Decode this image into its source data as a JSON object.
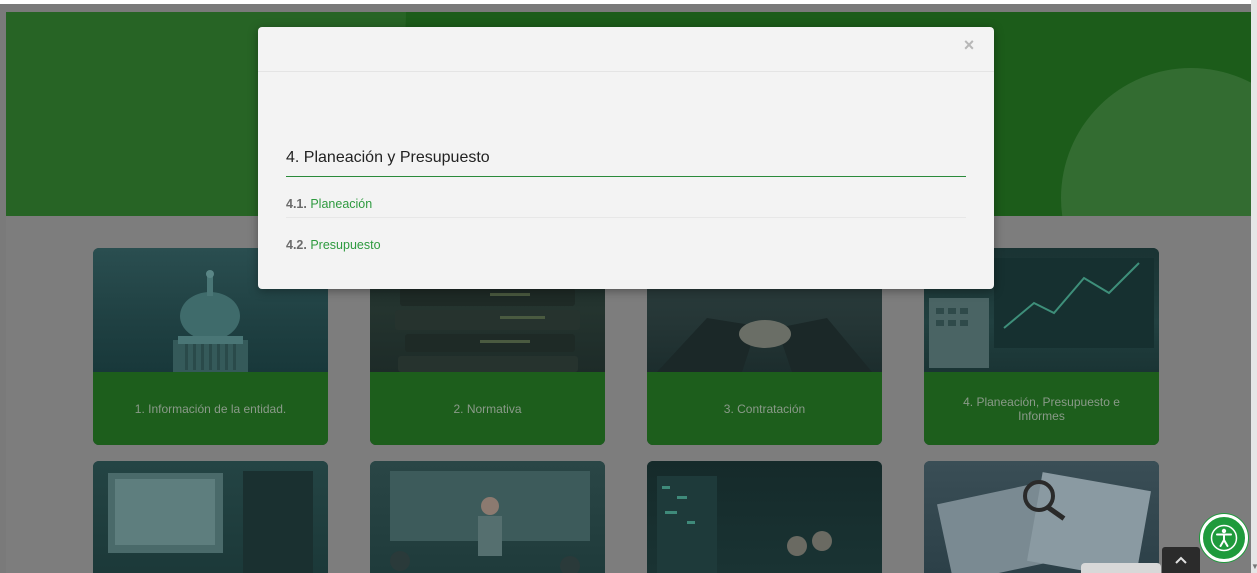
{
  "modal": {
    "close_icon": "×",
    "title": "4. Planeación y Presupuesto",
    "items": [
      {
        "number": "4.1.",
        "label": "Planeación"
      },
      {
        "number": "4.2.",
        "label": "Presupuesto"
      }
    ]
  },
  "cards": [
    {
      "label": "1. Información de la entidad.",
      "image": "capitol-building"
    },
    {
      "label": "2. Normativa",
      "image": "law-books"
    },
    {
      "label": "3. Contratación",
      "image": "handshake"
    },
    {
      "label": "4. Planeación, Presupuesto e Informes",
      "image": "chart-monitor"
    }
  ],
  "cards_bottom": [
    {
      "image": "computer-monitor"
    },
    {
      "image": "office-meeting"
    },
    {
      "image": "server-room"
    },
    {
      "image": "financial-documents"
    }
  ],
  "floating": {
    "accessibility_icon": "accessibility-icon",
    "back_to_top_icon": "chevron-up-icon"
  },
  "colors": {
    "hero_green": "#1c5c1a",
    "card_band_green": "#1d5e1c",
    "link_green": "#2e9a3f",
    "accessibility_green": "#1f9a3c"
  }
}
